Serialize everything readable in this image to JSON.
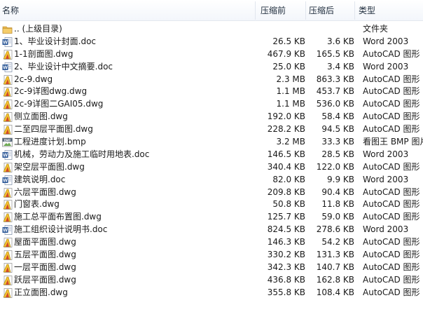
{
  "columns": {
    "name": "名称",
    "original_size": "压缩前",
    "compressed_size": "压缩后",
    "type": "类型"
  },
  "colors": {
    "folder": "#e8b64a",
    "word_blue": "#2b5797",
    "autocad_yellow": "#f2c230",
    "bmp_gray": "#8a8a8a"
  },
  "files": [
    {
      "name": ".. (上级目录)",
      "original": "",
      "compressed": "",
      "type": "文件夹",
      "icon": "folder-icon"
    },
    {
      "name": "1、毕业设计封面.doc",
      "original": "26.5 KB",
      "compressed": "3.6 KB",
      "type": "Word 2003",
      "icon": "word-document-icon"
    },
    {
      "name": "1-1剖面图.dwg",
      "original": "467.9 KB",
      "compressed": "165.5 KB",
      "type": "AutoCAD 图形",
      "icon": "autocad-drawing-icon"
    },
    {
      "name": "2、毕业设计中文摘要.doc",
      "original": "25.0 KB",
      "compressed": "3.4 KB",
      "type": "Word 2003",
      "icon": "word-document-icon"
    },
    {
      "name": "2c-9.dwg",
      "original": "2.3 MB",
      "compressed": "863.3 KB",
      "type": "AutoCAD 图形",
      "icon": "autocad-drawing-icon"
    },
    {
      "name": "2c-9详图dwg.dwg",
      "original": "1.1 MB",
      "compressed": "453.7 KB",
      "type": "AutoCAD 图形",
      "icon": "autocad-drawing-icon"
    },
    {
      "name": "2c-9详图二GAI05.dwg",
      "original": "1.1 MB",
      "compressed": "536.0 KB",
      "type": "AutoCAD 图形",
      "icon": "autocad-drawing-icon"
    },
    {
      "name": "侧立面图.dwg",
      "original": "192.0 KB",
      "compressed": "58.4 KB",
      "type": "AutoCAD 图形",
      "icon": "autocad-drawing-icon"
    },
    {
      "name": "二至四层平面图.dwg",
      "original": "228.2 KB",
      "compressed": "94.5 KB",
      "type": "AutoCAD 图形",
      "icon": "autocad-drawing-icon"
    },
    {
      "name": "工程进度计划.bmp",
      "original": "3.2 MB",
      "compressed": "33.3 KB",
      "type": "看图王 BMP 图片",
      "icon": "bmp-image-icon"
    },
    {
      "name": "机械，劳动力及施工临时用地表.doc",
      "original": "146.5 KB",
      "compressed": "28.5 KB",
      "type": "Word 2003",
      "icon": "word-document-icon"
    },
    {
      "name": "架空层平面图.dwg",
      "original": "340.4 KB",
      "compressed": "122.0 KB",
      "type": "AutoCAD 图形",
      "icon": "autocad-drawing-icon"
    },
    {
      "name": "建筑说明.doc",
      "original": "82.0 KB",
      "compressed": "9.9 KB",
      "type": "Word 2003",
      "icon": "word-document-icon"
    },
    {
      "name": "六层平面图.dwg",
      "original": "209.8 KB",
      "compressed": "90.4 KB",
      "type": "AutoCAD 图形",
      "icon": "autocad-drawing-icon"
    },
    {
      "name": "门窗表.dwg",
      "original": "50.8 KB",
      "compressed": "11.8 KB",
      "type": "AutoCAD 图形",
      "icon": "autocad-drawing-icon"
    },
    {
      "name": "施工总平面布置图.dwg",
      "original": "125.7 KB",
      "compressed": "59.0 KB",
      "type": "AutoCAD 图形",
      "icon": "autocad-drawing-icon"
    },
    {
      "name": "施工组织设计说明书.doc",
      "original": "824.5 KB",
      "compressed": "278.6 KB",
      "type": "Word 2003",
      "icon": "word-document-icon"
    },
    {
      "name": "屋面平面图.dwg",
      "original": "146.3 KB",
      "compressed": "54.2 KB",
      "type": "AutoCAD 图形",
      "icon": "autocad-drawing-icon"
    },
    {
      "name": "五层平面图.dwg",
      "original": "330.2 KB",
      "compressed": "131.3 KB",
      "type": "AutoCAD 图形",
      "icon": "autocad-drawing-icon"
    },
    {
      "name": "一层平面图.dwg",
      "original": "342.3 KB",
      "compressed": "140.7 KB",
      "type": "AutoCAD 图形",
      "icon": "autocad-drawing-icon"
    },
    {
      "name": "跃层平面图.dwg",
      "original": "436.8 KB",
      "compressed": "162.8 KB",
      "type": "AutoCAD 图形",
      "icon": "autocad-drawing-icon"
    },
    {
      "name": "正立面图.dwg",
      "original": "355.8 KB",
      "compressed": "108.4 KB",
      "type": "AutoCAD 图形",
      "icon": "autocad-drawing-icon"
    }
  ]
}
